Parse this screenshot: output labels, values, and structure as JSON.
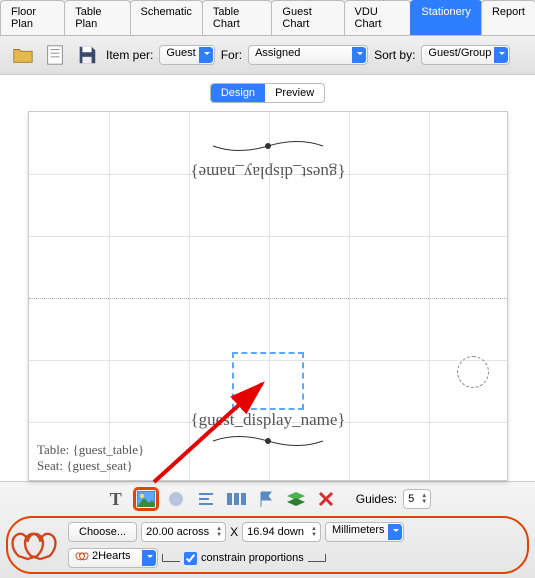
{
  "tabs": [
    "Floor Plan",
    "Table Plan",
    "Schematic",
    "Table Chart",
    "Guest Chart",
    "VDU Chart",
    "Stationery",
    "Report"
  ],
  "active_tab_index": 6,
  "toolbar": {
    "item_per_label": "Item per:",
    "item_per_value": "Guest",
    "for_label": "For:",
    "for_value": "Assigned",
    "sort_label": "Sort by:",
    "sort_value": "Guest/Group"
  },
  "view_seg": {
    "design": "Design",
    "preview": "Preview",
    "active": "design"
  },
  "card": {
    "top_placeholder": "{guest_display_name}",
    "bottom_placeholder": "{guest_display_name}",
    "table_line": "Table: {guest_table}",
    "seat_line": "Seat: {guest_seat}"
  },
  "guides": {
    "label": "Guides:",
    "value": "5"
  },
  "props": {
    "choose_btn": "Choose...",
    "width_value": "20.00 across",
    "x": "X",
    "height_value": "16.94 down",
    "unit": "Millimeters",
    "clipart": "2Hearts",
    "constrain": "constrain proportions"
  }
}
